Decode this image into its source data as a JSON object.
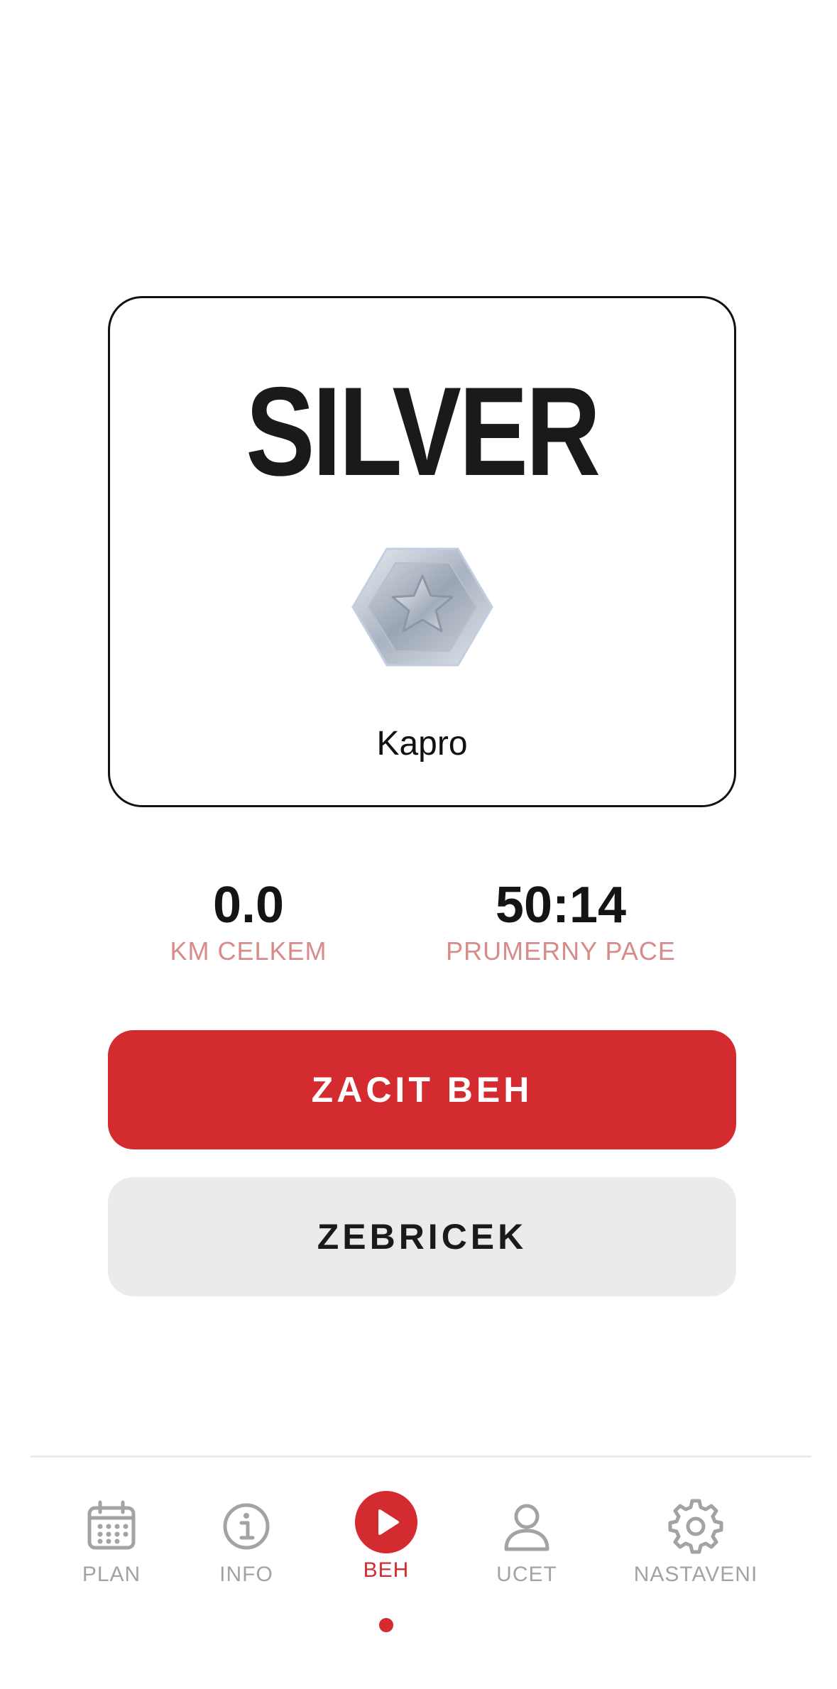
{
  "rank": {
    "title": "SILVER",
    "medal_icon": "silver-hexagon-star-medal-icon",
    "user_name": "Kapro"
  },
  "stats": {
    "km_value": "0.0",
    "km_label": "KM CELKEM",
    "pace_value": "50:14",
    "pace_label": "PRUMERNY PACE"
  },
  "actions": {
    "start_label": "ZACIT BEH",
    "leaderboard_label": "ZEBRICEK"
  },
  "tabbar": {
    "items": [
      {
        "label": "PLAN",
        "icon": "calendar-icon"
      },
      {
        "label": "INFO",
        "icon": "info-icon"
      },
      {
        "label": "BEH",
        "icon": "play-icon",
        "active": true
      },
      {
        "label": "UCET",
        "icon": "user-icon"
      },
      {
        "label": "NASTAVENI",
        "icon": "gear-icon"
      }
    ]
  },
  "colors": {
    "accent": "#d42b30",
    "stat_label": "#d98a8a",
    "inactive_tab": "#a3a3a3",
    "secondary_button": "#ebebeb"
  }
}
